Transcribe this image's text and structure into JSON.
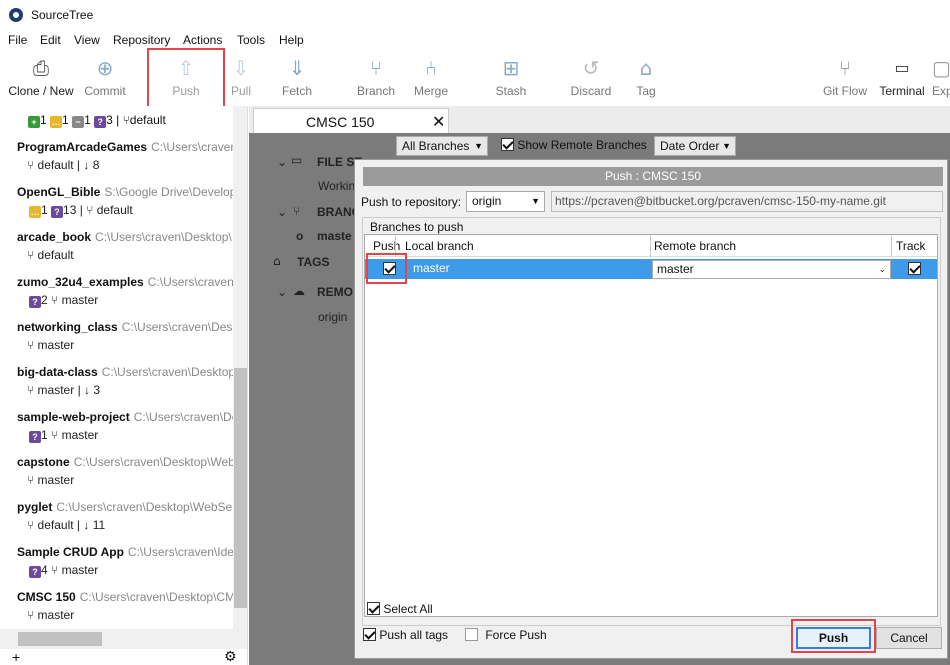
{
  "app": {
    "title": "SourceTree"
  },
  "menu": [
    "File",
    "Edit",
    "View",
    "Repository",
    "Actions",
    "Tools",
    "Help"
  ],
  "toolbar": [
    {
      "label": "Clone / New",
      "icon": "clone-icon"
    },
    {
      "label": "Commit",
      "icon": "commit-icon"
    },
    {
      "label": "Push",
      "icon": "push-icon"
    },
    {
      "label": "Pull",
      "icon": "pull-icon"
    },
    {
      "label": "Fetch",
      "icon": "fetch-icon"
    },
    {
      "label": "Branch",
      "icon": "branch-icon"
    },
    {
      "label": "Merge",
      "icon": "merge-icon"
    },
    {
      "label": "Stash",
      "icon": "stash-icon"
    },
    {
      "label": "Discard",
      "icon": "discard-icon"
    },
    {
      "label": "Tag",
      "icon": "tag-icon"
    },
    {
      "label": "Git Flow",
      "icon": "git-flow-icon"
    },
    {
      "label": "Terminal",
      "icon": "terminal-icon"
    },
    {
      "label": "Exp",
      "icon": "explorer-icon"
    }
  ],
  "sidebar": {
    "first_status": {
      "added": "1",
      "modified": "1",
      "removed": "1",
      "untracked": "3",
      "branch": "default"
    },
    "repos": [
      {
        "name": "ProgramArcadeGames",
        "path": "C:\\Users\\craven",
        "branch": "default",
        "behind": "↓ 8"
      },
      {
        "name": "OpenGL_Bible",
        "path": "S:\\Google Drive\\Develop",
        "modified": "1",
        "untracked": "13",
        "branch": "default"
      },
      {
        "name": "arcade_book",
        "path": "C:\\Users\\craven\\Desktop\\",
        "branch": "default"
      },
      {
        "name": "zumo_32u4_examples",
        "path": "C:\\Users\\craven",
        "untracked": "2",
        "branch": "master"
      },
      {
        "name": "networking_class",
        "path": "C:\\Users\\craven\\Desk",
        "branch": "master"
      },
      {
        "name": "big-data-class",
        "path": "C:\\Users\\craven\\Desktop",
        "branch": "master",
        "behind": "↓ 3"
      },
      {
        "name": "sample-web-project",
        "path": "C:\\Users\\craven\\De",
        "untracked": "1",
        "branch": "master"
      },
      {
        "name": "capstone",
        "path": "C:\\Users\\craven\\Desktop\\Web",
        "branch": "master"
      },
      {
        "name": "pyglet",
        "path": "C:\\Users\\craven\\Desktop\\WebSe",
        "branch": "default",
        "behind": "↓ 11"
      },
      {
        "name": "Sample CRUD App",
        "path": "C:\\Users\\craven\\Idea",
        "untracked": "4",
        "branch": "master"
      },
      {
        "name": "CMSC 150",
        "path": "C:\\Users\\craven\\Desktop\\CM",
        "branch": "master"
      }
    ]
  },
  "tab": {
    "title": "CMSC 150"
  },
  "nav": {
    "file_status": "FILE ST",
    "working": "Workin",
    "branches": "BRANC",
    "master": "maste",
    "tags": "TAGS",
    "remotes": "REMO",
    "origin": "origin"
  },
  "filters": {
    "branches": "All Branches",
    "show_remote": "Show Remote Branches",
    "order": "Date Order"
  },
  "dialog": {
    "title": "Push : CMSC 150",
    "repo_label": "Push to repository:",
    "repo_value": "origin",
    "url": "https://pcraven@bitbucket.org/pcraven/cmsc-150-my-name.git",
    "branches_label": "Branches to push",
    "headers": {
      "push": "Push",
      "local": "Local branch",
      "remote": "Remote branch",
      "track": "Track"
    },
    "row": {
      "local": "master",
      "remote": "master"
    },
    "select_all": "Select All",
    "push_all_tags": "Push all tags",
    "force_push": "Force Push",
    "push_button": "Push",
    "cancel_button": "Cancel"
  },
  "colors": {
    "highlight": "#e0464b",
    "selection": "#3d9be9"
  }
}
